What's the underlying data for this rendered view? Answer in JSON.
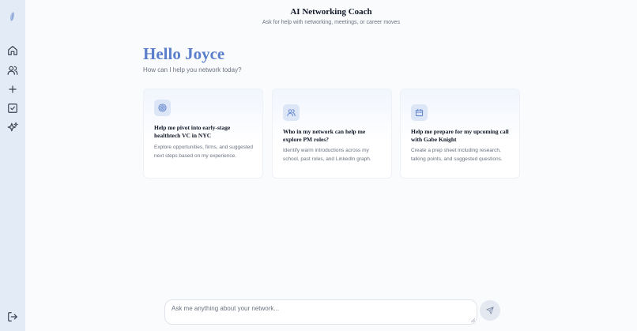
{
  "header": {
    "title": "AI Networking Coach",
    "subtitle": "Ask for help with networking, meetings, or career moves"
  },
  "sidebar": {
    "items": [
      {
        "icon": "home-icon"
      },
      {
        "icon": "people-icon"
      },
      {
        "icon": "plus-icon"
      },
      {
        "icon": "checkbox-icon"
      },
      {
        "icon": "sparkles-icon"
      }
    ],
    "logout_icon": "logout-icon",
    "logo_icon": "leaf-logo-icon"
  },
  "main": {
    "greeting": "Hello Joyce",
    "prompt": "How can I help you network today?",
    "cards": [
      {
        "icon": "target-icon",
        "title": "Help me pivot into early-stage healthtech VC in NYC",
        "description": "Explore opportunities, firms, and suggested next steps based on my experience."
      },
      {
        "icon": "people-icon",
        "title": "Who in my network can help me explore PM roles?",
        "description": "Identify warm introductions across my school, past roles, and LinkedIn graph."
      },
      {
        "icon": "calendar-icon",
        "title": "Help me prepare for my upcoming call with Gabe Knight",
        "description": "Create a prep sheet including research, talking points, and suggested questions."
      }
    ]
  },
  "composer": {
    "placeholder": "Ask me anything about your network...",
    "value": "",
    "send_icon": "send-icon"
  },
  "colors": {
    "accent": "#5b7fcb",
    "sidebar_bg": "#e3ebf6",
    "icon_bg": "#dde6f6"
  }
}
